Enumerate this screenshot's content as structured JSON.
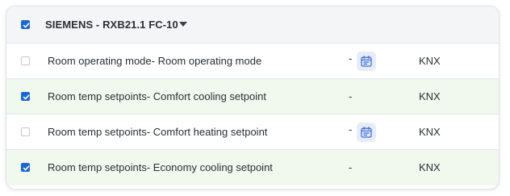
{
  "group": {
    "title": "SIEMENS - RXB21.1 FC-10",
    "checked": true
  },
  "rows": [
    {
      "name": "Room operating mode- Room operating mode",
      "value": "-",
      "protocol": "KNX",
      "checked": false,
      "has_calendar": true
    },
    {
      "name": "Room temp setpoints- Comfort cooling setpoint",
      "value": "-",
      "protocol": "KNX",
      "checked": true,
      "has_calendar": false
    },
    {
      "name": "Room temp setpoints- Comfort heating setpoint",
      "value": "-",
      "protocol": "KNX",
      "checked": false,
      "has_calendar": true
    },
    {
      "name": "Room temp setpoints- Economy cooling setpoint",
      "value": "-",
      "protocol": "KNX",
      "checked": true,
      "has_calendar": false
    }
  ],
  "colors": {
    "checkbox_checked": "#1a67d6",
    "selected_row_bg": "#f1f8ee",
    "calendar_icon": "#3f6fd8"
  },
  "icons": {
    "group_toggle": "chevron-down-icon",
    "schedule": "calendar-icon",
    "check": "check-icon"
  }
}
